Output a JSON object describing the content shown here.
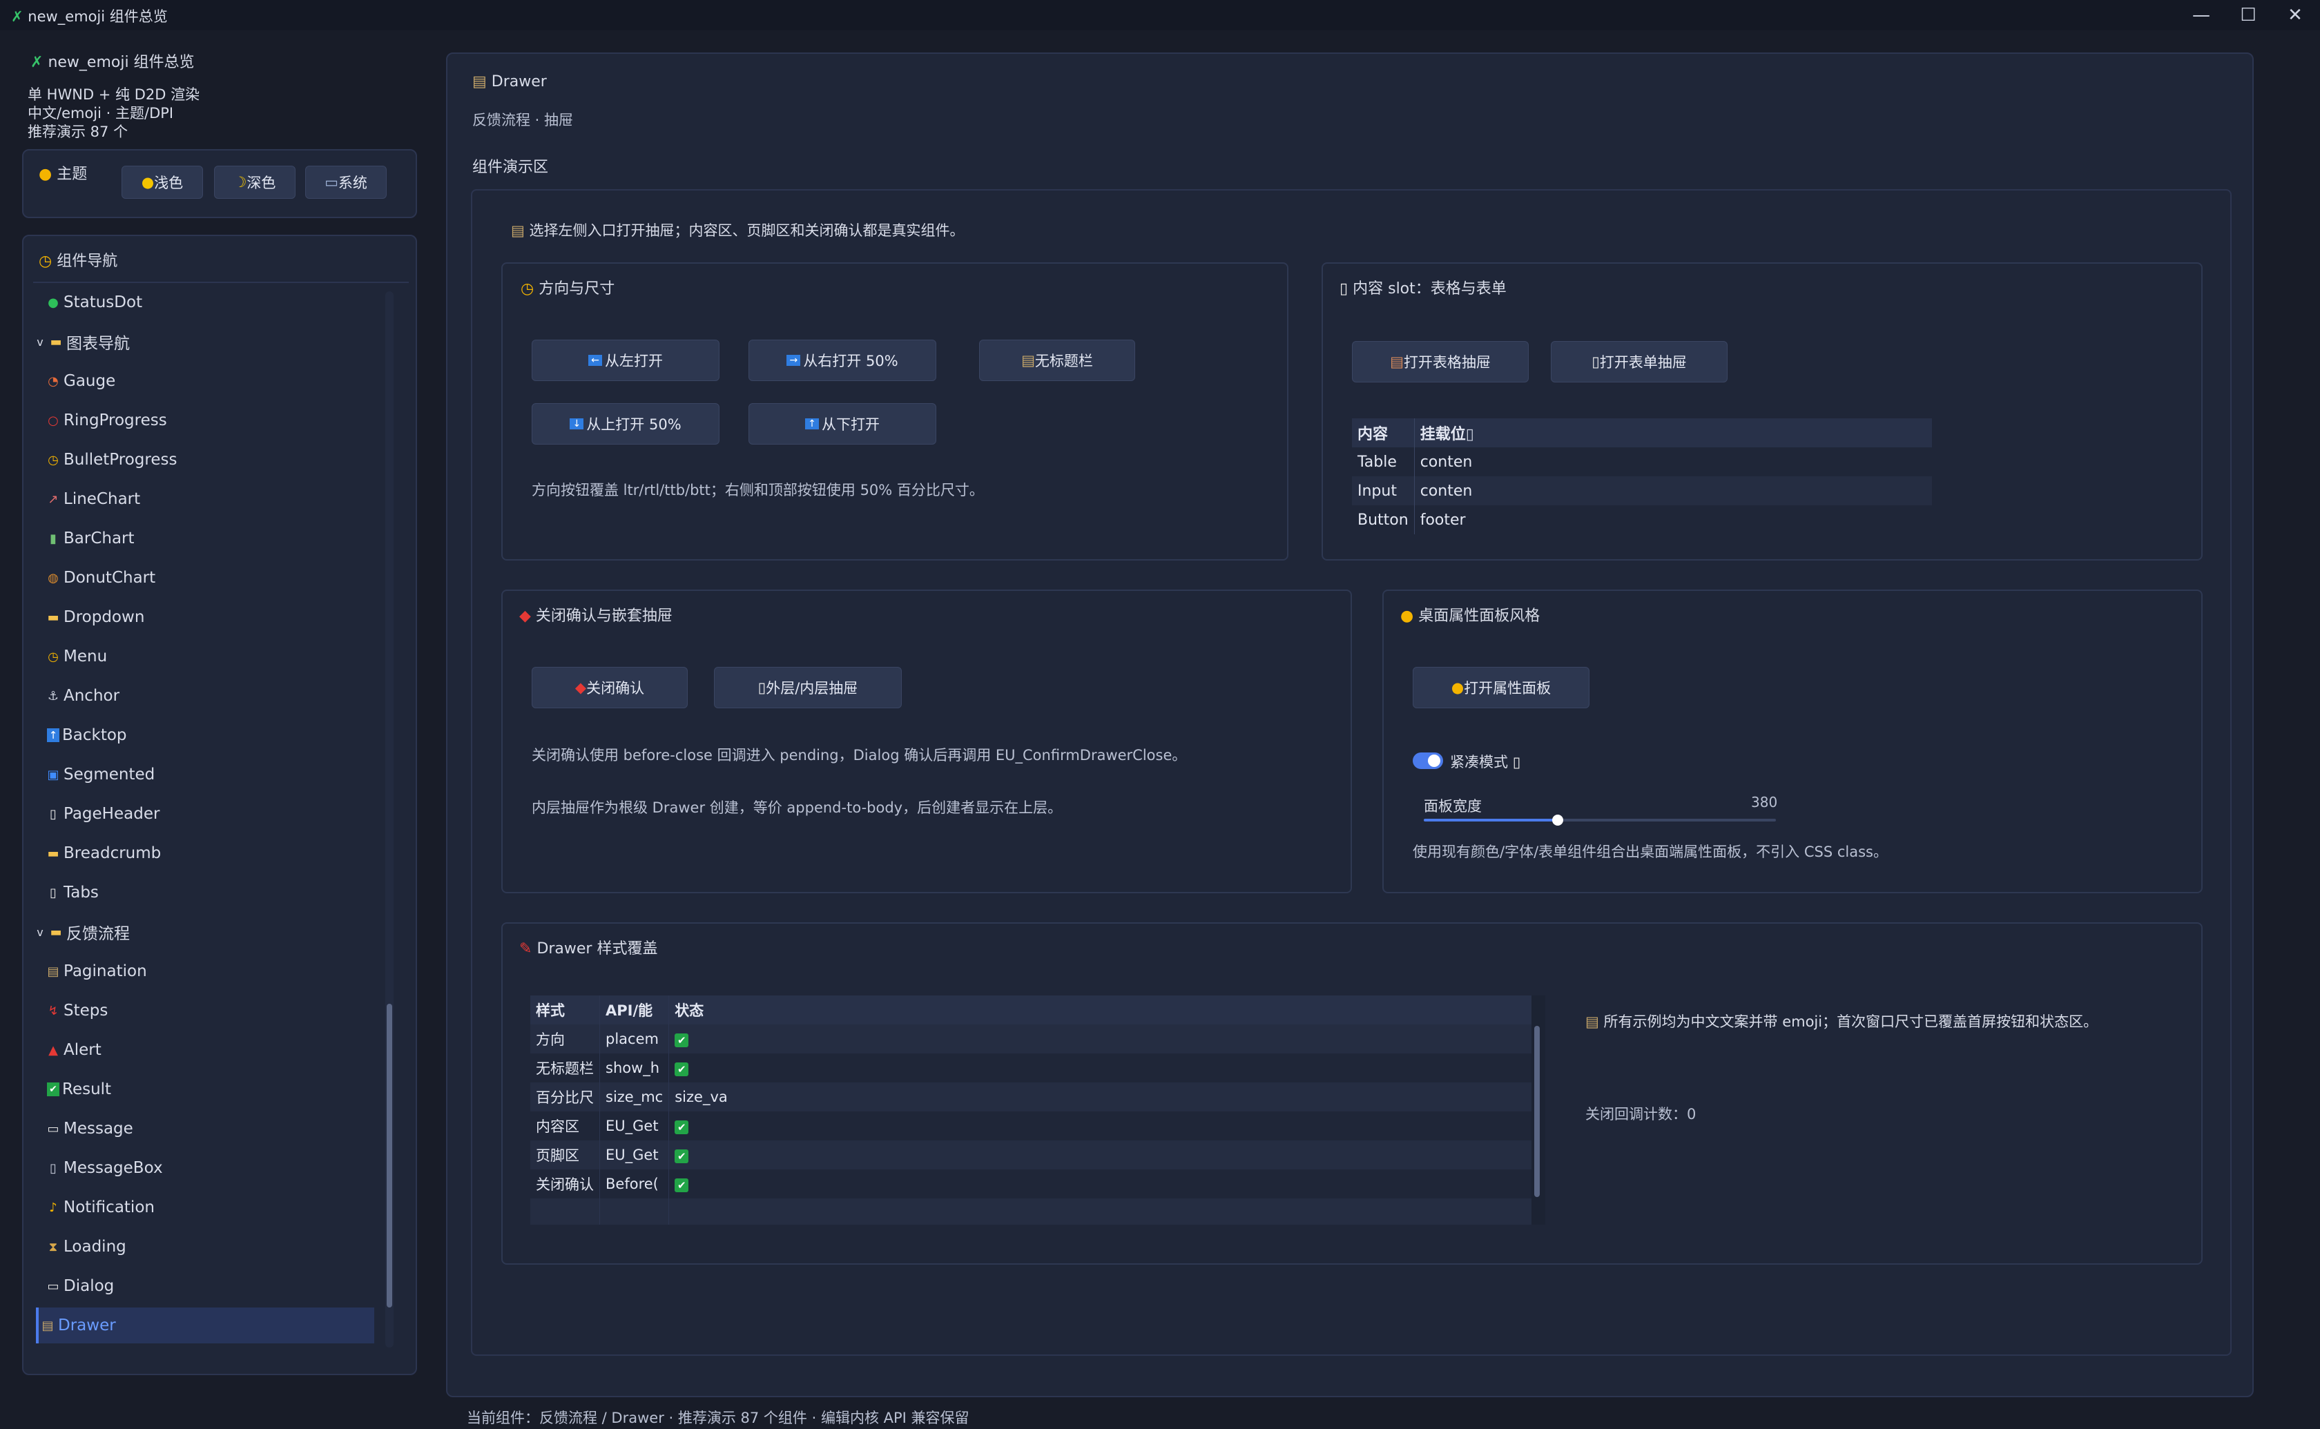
{
  "window": {
    "title": "new_emoji 组件总览",
    "minimize": "—",
    "maximize": "☐",
    "close": "✕"
  },
  "sidebar": {
    "app_title": "new_emoji 组件总览",
    "info_lines": [
      "单 HWND + 纯 D2D 渲染",
      "中文/emoji · 主题/DPI",
      "推荐演示 87 个"
    ],
    "theme": {
      "label": "主题",
      "buttons": [
        "浅色",
        "深色",
        "系统"
      ]
    },
    "nav": {
      "title": "组件导航",
      "items": [
        {
          "label": "StatusDot",
          "icon": "●"
        },
        {
          "label": "图表导航",
          "icon": "▬",
          "group": true
        },
        {
          "label": "Gauge",
          "icon": "◔"
        },
        {
          "label": "RingProgress",
          "icon": "○"
        },
        {
          "label": "BulletProgress",
          "icon": "◷"
        },
        {
          "label": "LineChart",
          "icon": "↗"
        },
        {
          "label": "BarChart",
          "icon": "▮"
        },
        {
          "label": "DonutChart",
          "icon": "◍"
        },
        {
          "label": "Dropdown",
          "icon": "▬"
        },
        {
          "label": "Menu",
          "icon": "◷"
        },
        {
          "label": "Anchor",
          "icon": "⚓"
        },
        {
          "label": "Backtop",
          "icon": "↑"
        },
        {
          "label": "Segmented",
          "icon": "▣"
        },
        {
          "label": "PageHeader",
          "icon": "▯"
        },
        {
          "label": "Breadcrumb",
          "icon": "▬"
        },
        {
          "label": "Tabs",
          "icon": "▯"
        },
        {
          "label": "反馈流程",
          "icon": "▬",
          "group": true
        },
        {
          "label": "Pagination",
          "icon": "▤"
        },
        {
          "label": "Steps",
          "icon": "↯"
        },
        {
          "label": "Alert",
          "icon": "▲"
        },
        {
          "label": "Result",
          "icon": "✔"
        },
        {
          "label": "Message",
          "icon": "▭"
        },
        {
          "label": "MessageBox",
          "icon": "▯"
        },
        {
          "label": "Notification",
          "icon": "♪"
        },
        {
          "label": "Loading",
          "icon": "⧗"
        },
        {
          "label": "Dialog",
          "icon": "▭"
        },
        {
          "label": "Drawer",
          "icon": "▤",
          "selected": true
        }
      ]
    }
  },
  "main": {
    "title": "Drawer",
    "subtitle": "反馈流程 · 抽屉",
    "demo_label": "组件演示区",
    "intro": "选择左侧入口打开抽屉；内容区、页脚区和关闭确认都是真实组件。",
    "direction_card": {
      "title": "方向与尺寸",
      "buttons": [
        "从左打开",
        "从右打开 50%",
        "无标题栏",
        "从上打开 50%",
        "从下打开"
      ],
      "note": "方向按钮覆盖 ltr/rtl/ttb/btt；右侧和顶部按钮使用 50% 百分比尺寸。"
    },
    "slot_card": {
      "title": "内容 slot：表格与表单",
      "buttons": [
        "打开表格抽屉",
        "打开表单抽屉"
      ],
      "table": {
        "headers": [
          "内容",
          "挂载位"
        ],
        "rows": [
          [
            "Table",
            "conten"
          ],
          [
            "Input",
            "conten"
          ],
          [
            "Button",
            "footer"
          ]
        ]
      }
    },
    "confirm_card": {
      "title": "关闭确认与嵌套抽屉",
      "buttons": [
        "关闭确认",
        "外层/内层抽屉"
      ],
      "note1": "关闭确认使用 before-close 回调进入 pending，Dialog 确认后再调用 EU_ConfirmDrawerClose。",
      "note2": "内层抽屉作为根级 Drawer 创建，等价 append-to-body，后创建者显示在上层。"
    },
    "props_card": {
      "title": "桌面属性面板风格",
      "button": "打开属性面板",
      "toggle_label": "紧凑模式",
      "toggle_on": true,
      "slider_label": "面板宽度",
      "slider_value": "380",
      "slider_fraction": 0.38,
      "note": "使用现有颜色/字体/表单组件组合出桌面端属性面板，不引入 CSS class。"
    },
    "style_card": {
      "title": "Drawer 样式覆盖",
      "table": {
        "headers": [
          "样式",
          "API/能",
          "状态"
        ],
        "rows": [
          [
            "方向",
            "placem",
            "✔"
          ],
          [
            "无标题栏",
            "show_h",
            "✔"
          ],
          [
            "百分比尺",
            "size_mc",
            "size_va"
          ],
          [
            "内容区",
            "EU_Get",
            "✔"
          ],
          [
            "页脚区",
            "EU_Get",
            "✔"
          ],
          [
            "关闭确认",
            "Before(",
            "✔"
          ]
        ]
      },
      "side_note": "所有示例均为中文文案并带 emoji；首次窗口尺寸已覆盖首屏按钮和状态区。",
      "counter": "关闭回调计数：0"
    }
  },
  "statusbar": {
    "text": "当前组件：反馈流程 / Drawer · 推荐演示 87 个组件 · 编辑内核 API 兼容保留"
  },
  "colors": {
    "background": "#181c28",
    "panel": "#1f2638",
    "button": "#2d3750",
    "accent": "#4b7bec",
    "selected_text": "#6a9cff",
    "check": "#22a447"
  }
}
